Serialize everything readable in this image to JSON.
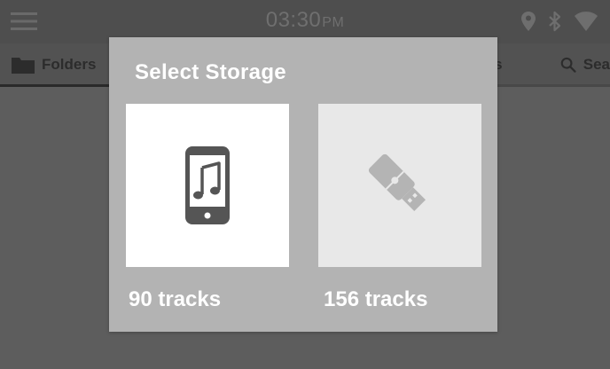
{
  "status_bar": {
    "time": "03:30",
    "ampm": "PM",
    "icons": [
      "menu-icon",
      "location-icon",
      "bluetooth-icon",
      "wifi-icon"
    ]
  },
  "tabs": [
    {
      "label": "Folders",
      "icon": "folder-icon",
      "active": true
    },
    {
      "label": "ongs"
    },
    {
      "label": "Sea",
      "icon": "search-icon"
    }
  ],
  "dialog": {
    "title": "Select Storage",
    "options": [
      {
        "icon": "phone-music-icon",
        "tracks": "90 tracks",
        "selected": true
      },
      {
        "icon": "usb-drive-icon",
        "tracks": "156 tracks",
        "selected": false
      }
    ]
  },
  "colors": {
    "background": "#5d5d5d",
    "dialog": "#b3b3b3",
    "selected_tile": "#ffffff",
    "unselected_tile": "#e8e8e8"
  }
}
